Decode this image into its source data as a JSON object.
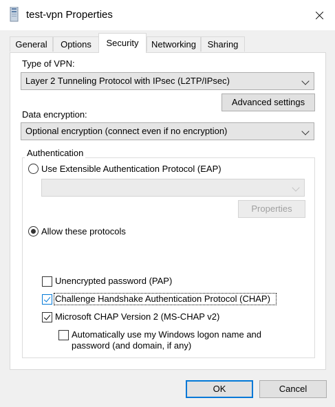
{
  "window": {
    "title": "test-vpn Properties",
    "icon": "network-connection-icon"
  },
  "tabs": [
    {
      "label": "General",
      "active": false
    },
    {
      "label": "Options",
      "active": false
    },
    {
      "label": "Security",
      "active": true
    },
    {
      "label": "Networking",
      "active": false
    },
    {
      "label": "Sharing",
      "active": false
    }
  ],
  "security": {
    "vpn_type_label": "Type of VPN:",
    "vpn_type_value": "Layer 2 Tunneling Protocol with IPsec (L2TP/IPsec)",
    "advanced_settings_label": "Advanced settings",
    "encryption_label": "Data encryption:",
    "encryption_value": "Optional encryption (connect even if no encryption)",
    "auth_group_label": "Authentication",
    "eap_radio_label": "Use Extensible Authentication Protocol (EAP)",
    "eap_selected": false,
    "eap_combo_value": "",
    "properties_label": "Properties",
    "allow_radio_label": "Allow these protocols",
    "allow_selected": true,
    "protocols": [
      {
        "label": "Unencrypted password (PAP)",
        "checked": false
      },
      {
        "label": "Challenge Handshake Authentication Protocol (CHAP)",
        "checked": true,
        "focused": true
      },
      {
        "label": "Microsoft CHAP Version 2 (MS-CHAP v2)",
        "checked": true
      }
    ],
    "auto_logon_line1": "Automatically use my Windows logon name and",
    "auto_logon_line2": "password (and domain, if any)",
    "auto_logon_checked": false
  },
  "footer": {
    "ok_label": "OK",
    "cancel_label": "Cancel"
  }
}
